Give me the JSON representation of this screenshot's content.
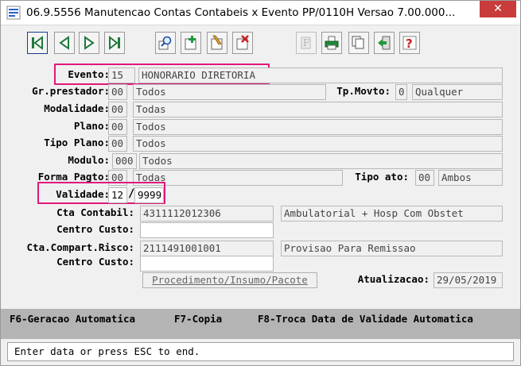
{
  "window": {
    "title": "06.9.5556 Manutencao  Contas Contabeis x Evento PP/0110H Versao 7.00.000...",
    "close_glyph": "✕"
  },
  "form": {
    "evento": {
      "label": "Evento:",
      "code": "15",
      "desc": "HONORARIO DIRETORIA"
    },
    "gr_prestador": {
      "label": "Gr.prestador:",
      "code": "00",
      "desc": "Todos"
    },
    "tp_movto": {
      "label": "Tp.Movto:",
      "code": "0",
      "desc": "Qualquer"
    },
    "modalidade": {
      "label": "Modalidade:",
      "code": "00",
      "desc": "Todas"
    },
    "plano": {
      "label": "Plano:",
      "code": "00",
      "desc": "Todos"
    },
    "tipo_plano": {
      "label": "Tipo Plano:",
      "code": "00",
      "desc": "Todos"
    },
    "modulo": {
      "label": "Modulo:",
      "code": "000",
      "desc": "Todos"
    },
    "forma_pagto": {
      "label": "Forma Pagto:",
      "code": "00",
      "desc": "Todas"
    },
    "tipo_ato": {
      "label": "Tipo ato:",
      "code": "00",
      "desc": "Ambos"
    },
    "validade": {
      "label": "Validade:",
      "month": "12",
      "sep": "/",
      "year": "9999"
    },
    "cta_contabil": {
      "label": "Cta Contabil:",
      "value": "4311112012306",
      "desc": "Ambulatorial + Hosp Com Obstet"
    },
    "centro_custo_1": {
      "label": "Centro Custo:",
      "value": ""
    },
    "cta_compart_risco": {
      "label": "Cta.Compart.Risco:",
      "value": "2111491001001",
      "desc": "Provisao Para Remissao"
    },
    "centro_custo_2": {
      "label": "Centro Custo:",
      "value": ""
    },
    "proc_button": "Procedimento/Insumo/Pacote",
    "atualizacao": {
      "label": "Atualizacao:",
      "value": "29/05/2019"
    }
  },
  "function_keys": {
    "f6": "F6-Geracao Automatica",
    "f7": "F7-Copia",
    "f8": "F8-Troca Data de Validade Automatica"
  },
  "status_bar": "Enter data or press ESC to end.",
  "colors": {
    "highlight": "#e0187a",
    "fkey_bar": "#b4b4b4",
    "close_button": "#c83c3c"
  }
}
